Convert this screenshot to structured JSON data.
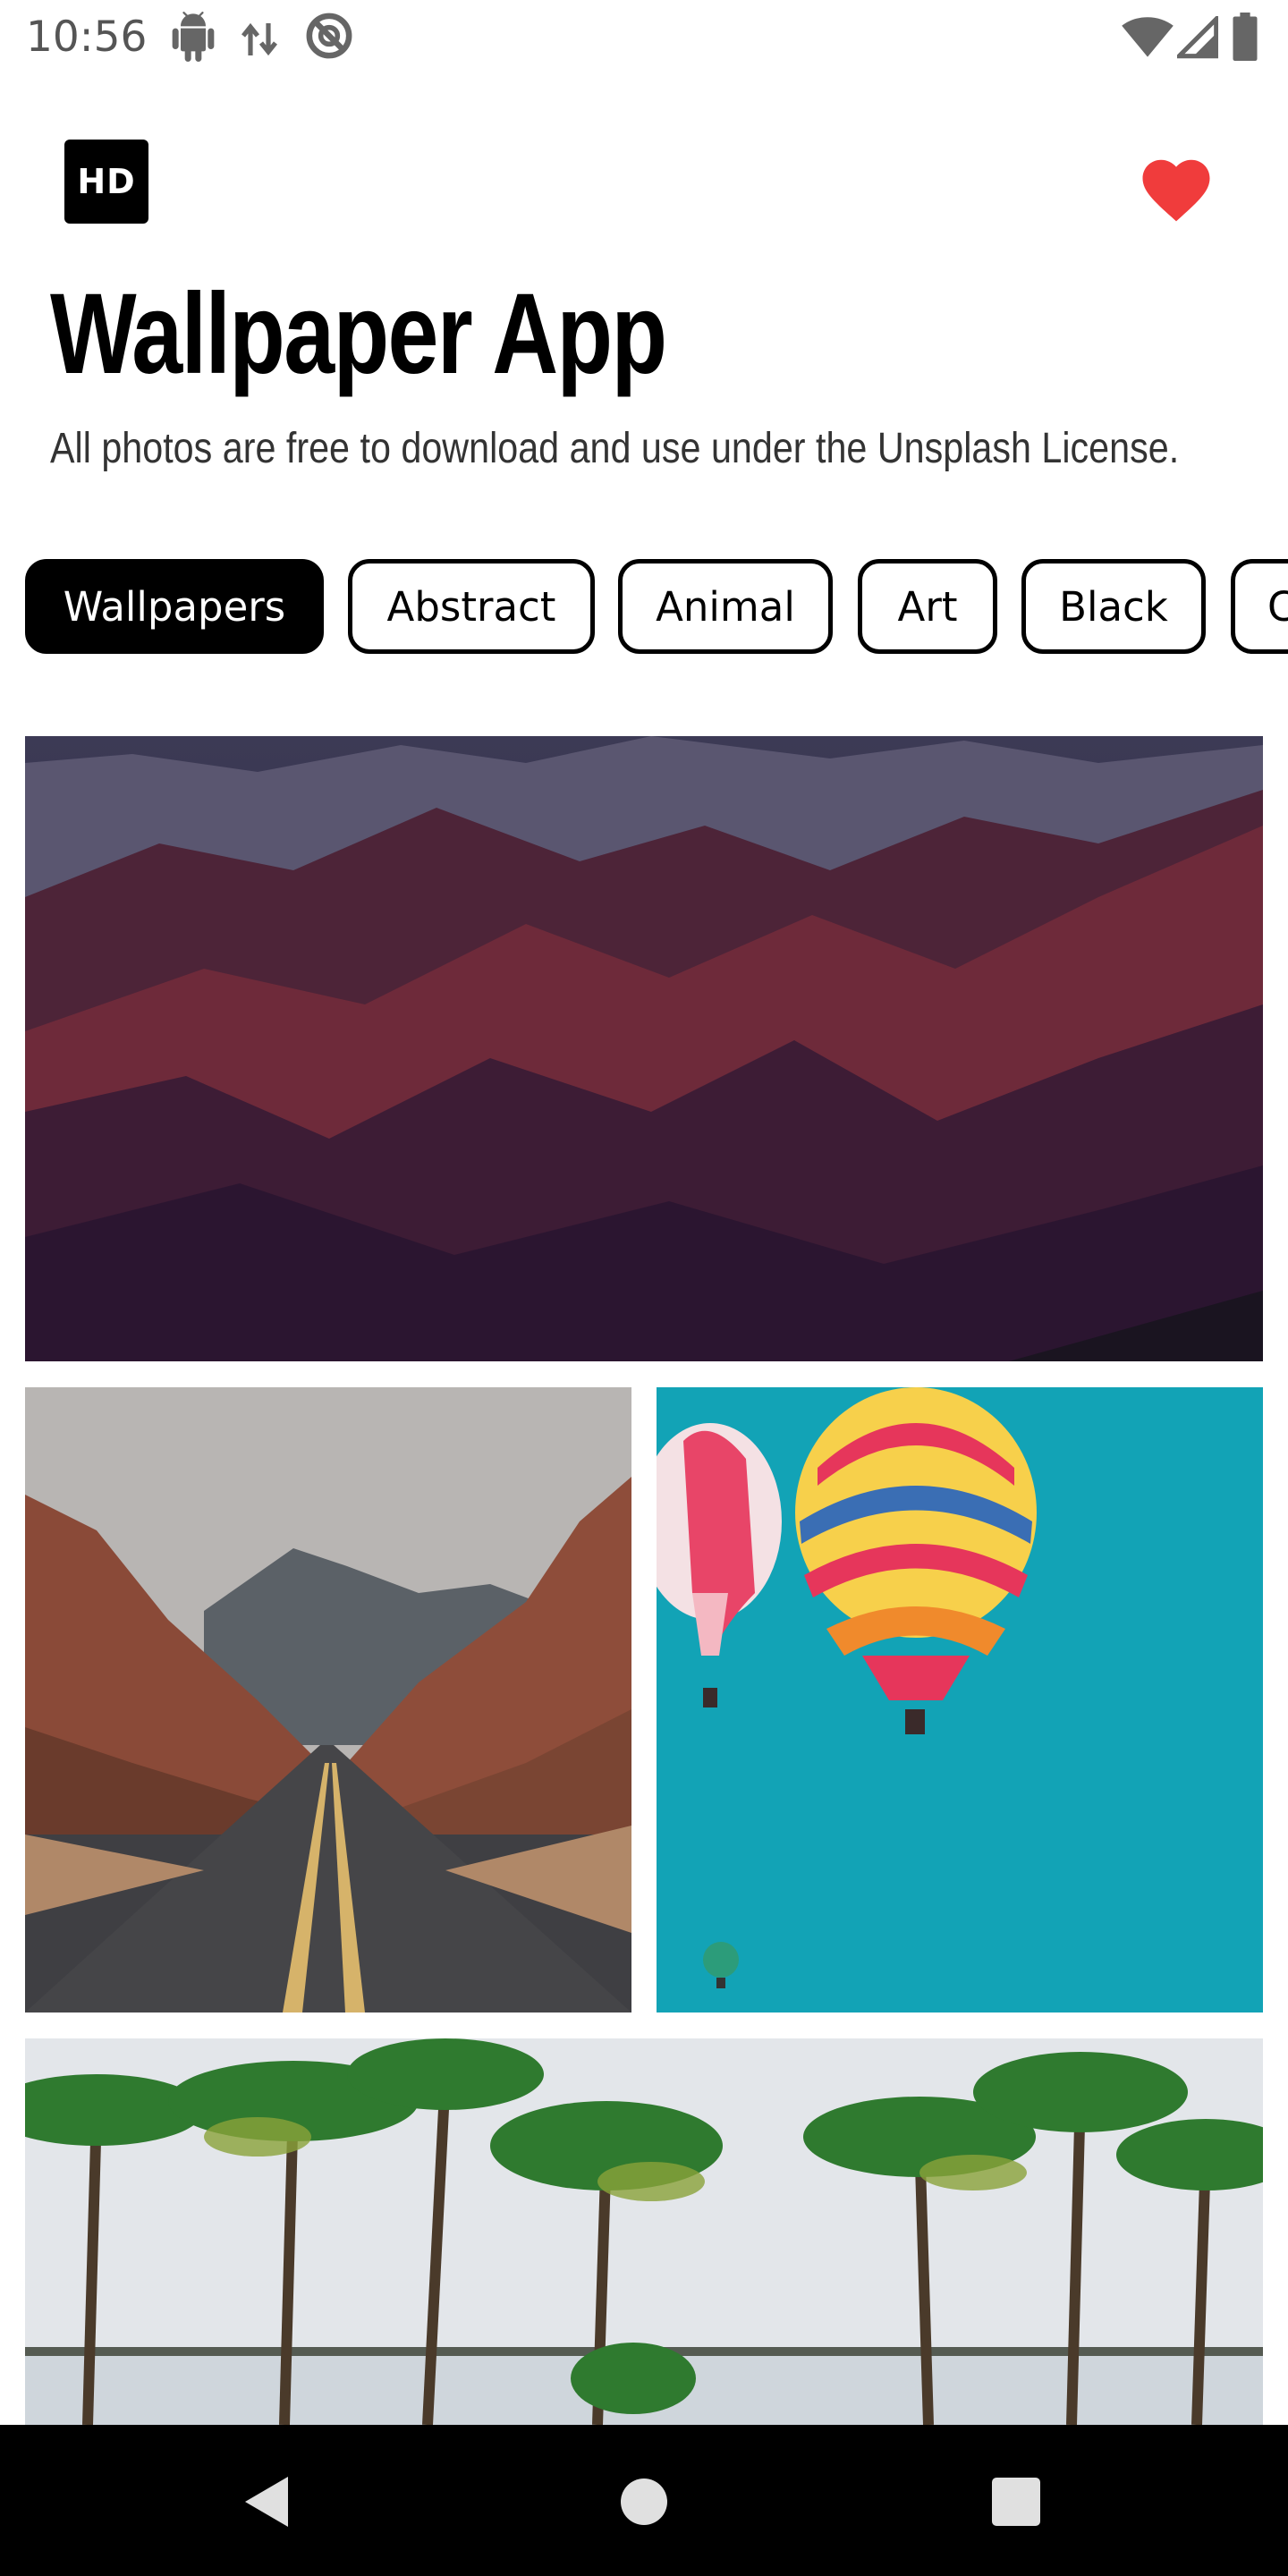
{
  "status_bar": {
    "time": "10:56",
    "icons": [
      "android-icon",
      "data-transfer-icon",
      "do-not-disturb-icon",
      "wifi-icon",
      "signal-icon",
      "battery-icon"
    ]
  },
  "header": {
    "logo_text": "HD",
    "title": "Wallpaper App",
    "subtitle": "All photos are free to download and use under the Unsplash License.",
    "favorite_icon": "heart-icon",
    "favorite_color": "#f03c3c"
  },
  "categories": {
    "items": [
      "Wallpapers",
      "Abstract",
      "Animal",
      "Art",
      "Black",
      "C"
    ],
    "selected": "Wallpapers"
  },
  "gallery": {
    "images": [
      "mountains-photo",
      "desert-road-photo",
      "hot-air-balloons-photo",
      "palm-trees-photo"
    ]
  },
  "nav_bar": {
    "icons": [
      "back-icon",
      "home-icon",
      "recents-icon"
    ]
  }
}
